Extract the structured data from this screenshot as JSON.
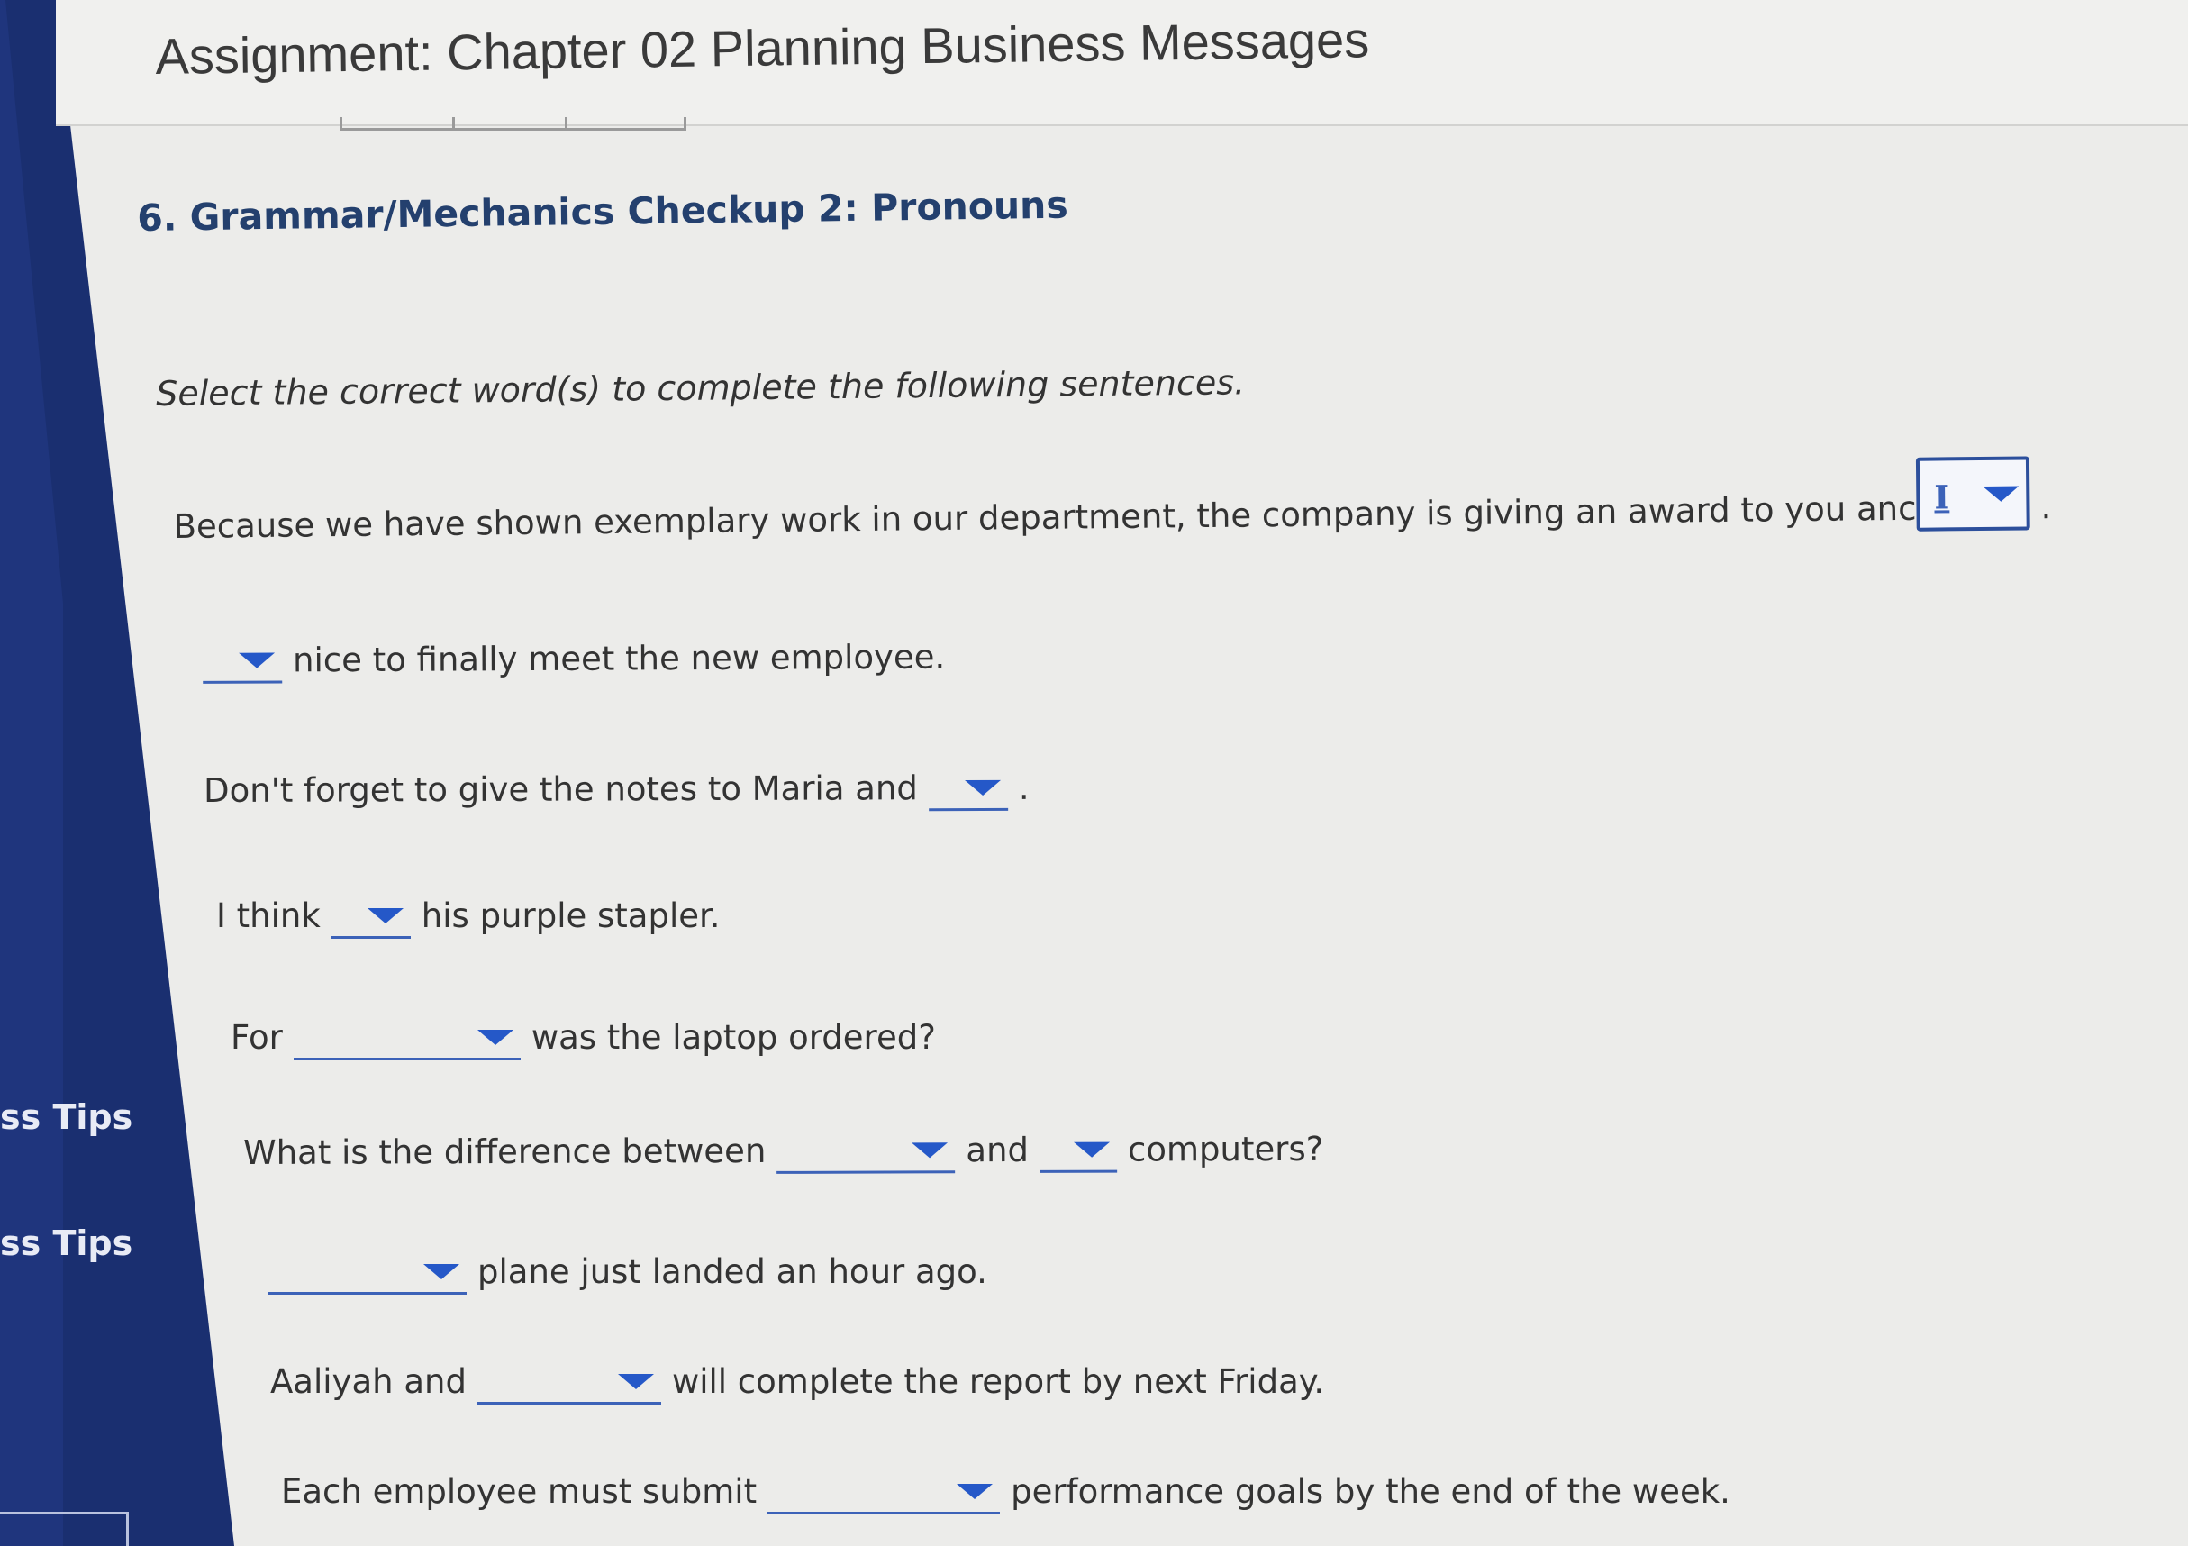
{
  "page": {
    "title": "Assignment: Chapter 02 Planning Business Messages"
  },
  "sidebar": {
    "tips": [
      "ss Tips",
      "ss Tips"
    ]
  },
  "question": {
    "title": "6. Grammar/Mechanics Checkup 2: Pronouns",
    "instructions": "Select the correct word(s) to complete the following sentences."
  },
  "sentences": [
    {
      "before": "Because we have shown exemplary work in our department, the company is giving an award to you anc",
      "selected": "I",
      "after": "."
    },
    {
      "before": "",
      "selected": "",
      "after": "nice to finally meet the new employee."
    },
    {
      "before": "Don't forget to give the notes to Maria and",
      "selected": "",
      "after": "."
    },
    {
      "before": "I think",
      "selected": "",
      "after": "his purple stapler."
    },
    {
      "before": "For",
      "selected": "",
      "after": "was the laptop ordered?"
    },
    {
      "before": "What is the difference between",
      "selected": "",
      "middle": "and",
      "selected2": "",
      "after": "computers?"
    },
    {
      "before": "",
      "selected": "",
      "after": "plane just landed an hour ago."
    },
    {
      "before": "Aaliyah and",
      "selected": "",
      "after": "will complete the report by next Friday."
    },
    {
      "before": "Each employee must submit",
      "selected": "",
      "after": "performance goals by the end of the week."
    }
  ],
  "icons": {
    "dropdown": "chevron-down-icon"
  },
  "colors": {
    "sidebar": "#1a2f70",
    "accent": "#2558c8",
    "heading": "#24406e"
  }
}
